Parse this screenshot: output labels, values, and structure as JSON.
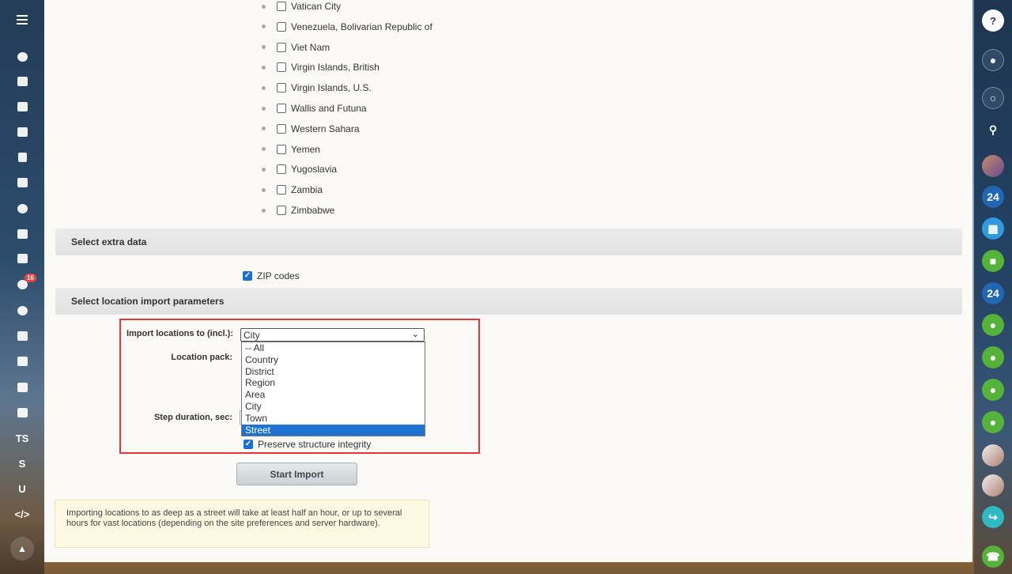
{
  "countries": [
    {
      "label": "Vatican City",
      "checked": false
    },
    {
      "label": "Venezuela, Bolivarian Republic of",
      "checked": false
    },
    {
      "label": "Viet Nam",
      "checked": false
    },
    {
      "label": "Virgin Islands, British",
      "checked": false
    },
    {
      "label": "Virgin Islands, U.S.",
      "checked": false
    },
    {
      "label": "Wallis and Futuna",
      "checked": false
    },
    {
      "label": "Western Sahara",
      "checked": false
    },
    {
      "label": "Yemen",
      "checked": false
    },
    {
      "label": "Yugoslavia",
      "checked": false
    },
    {
      "label": "Zambia",
      "checked": false
    },
    {
      "label": "Zimbabwe",
      "checked": false
    }
  ],
  "extra": {
    "title": "Select extra data",
    "zip_label": "ZIP codes",
    "zip_checked": true
  },
  "params": {
    "title": "Select location import parameters",
    "import_label": "Import locations to (incl.):",
    "import_value": "City",
    "options": [
      "-- All",
      "Country",
      "District",
      "Region",
      "Area",
      "City",
      "Town",
      "Street"
    ],
    "highlighted_option": "Street",
    "pack_label": "Location pack:",
    "step_label": "Step duration, sec:",
    "preserve_label": "Preserve structure integrity",
    "preserve_checked": true,
    "start_button": "Start Import"
  },
  "note": "Importing locations to as deep as a street will take at least half an hour, or up to several hours for vast locations (depending on the site preferences and server hardware).",
  "left_nav": {
    "badge_count": "16",
    "text_items": [
      "TS",
      "S",
      "U",
      "</>"
    ]
  },
  "right_nav": {
    "bitrix_label": "24",
    "help_label": "?"
  },
  "colors": {
    "accent_blue": "#1e73d2",
    "highlight_red": "#e8333a",
    "badge_red": "#f0423a"
  }
}
